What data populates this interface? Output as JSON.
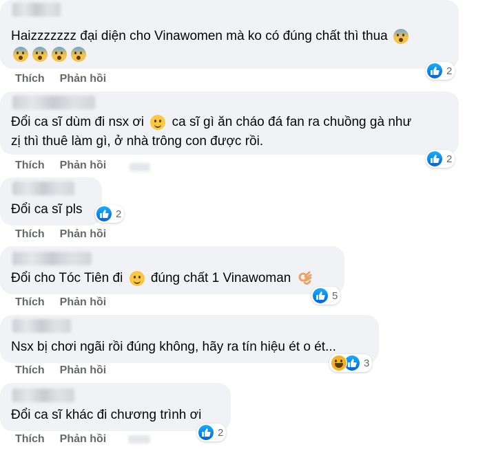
{
  "actions": {
    "like": "Thích",
    "reply": "Phản hồi"
  },
  "comments": [
    {
      "line1": "Haizzzzzzz đại diện cho Vinawomen mà ko có đúng chất thì thua",
      "reaction_count": "2"
    },
    {
      "line1_a": "Đổi ca sĩ dùm đi nsx ơi",
      "line1_b": "ca sĩ gì ăn cháo đá fan ra chuồng gà như",
      "line2": "zị thì thuê làm gì, ở nhà trông con được rồi.",
      "reaction_count": "2"
    },
    {
      "line1": "Đổi ca sĩ pls",
      "reaction_count": "2"
    },
    {
      "line1_a": "Đổi cho Tóc Tiên đi",
      "line1_b": "đúng chất 1 Vinawoman",
      "reaction_count": "5"
    },
    {
      "line1": "Nsx bị chơi ngãi rồi đúng không, hãy ra tín hiệu ét o ét...",
      "reaction_count": "3"
    },
    {
      "line1": "Đổi ca sĩ khác đi chương trình ơi",
      "reaction_count": "2"
    }
  ],
  "colors": {
    "like_blue": "#1877f2",
    "bubble": "#f0f2f5",
    "meta": "#65676b"
  }
}
